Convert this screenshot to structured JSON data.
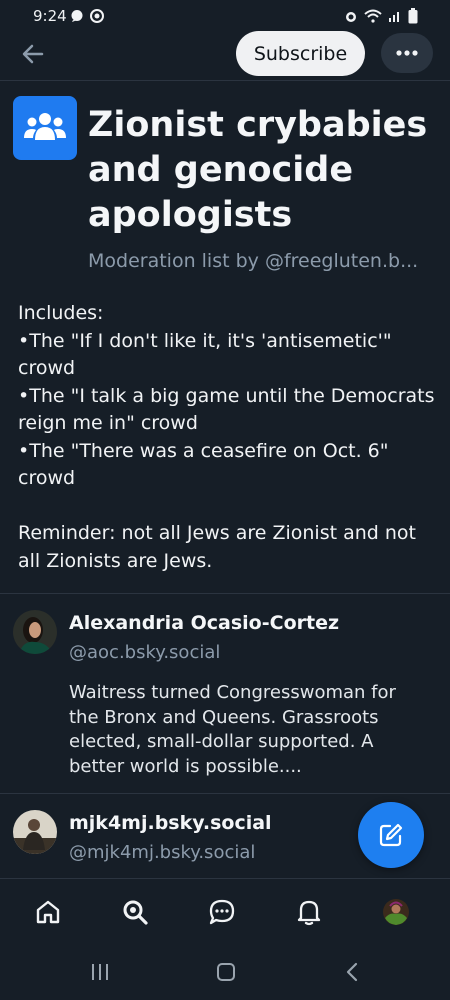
{
  "status_bar": {
    "time": "9:24"
  },
  "header": {
    "subscribe_label": "Subscribe",
    "more_label": "•••"
  },
  "list": {
    "title": "Zionist crybabies and genocide apologists",
    "byline": "Moderation list by @freegluten.b...",
    "description_lines": [
      "Includes:",
      "•The \"If I don't like it, it's 'antisemetic'\" crowd",
      "•The \"I talk a big game until the Democrats reign me in\" crowd",
      "•The \"There was a ceasefire on Oct. 6\" crowd",
      "",
      "Reminder: not all Jews are Zionist and not all Zionists are Jews."
    ]
  },
  "members": [
    {
      "name": "Alexandria Ocasio-Cortez",
      "handle": "@aoc.bsky.social",
      "bio": "Waitress turned Congresswoman for the Bronx and Queens. Grassroots elected, small-dollar supported. A better world is possible...."
    },
    {
      "name": "mjk4mj.bsky.social",
      "handle": "@mjk4mj.bsky.social",
      "bio": ""
    }
  ],
  "icons": {
    "back": "arrow-left-icon",
    "more": "ellipsis-icon",
    "list_avatar": "users-group-icon",
    "compose": "compose-icon",
    "nav": [
      "home-icon",
      "search-icon",
      "chat-icon",
      "bell-icon",
      "profile-avatar"
    ]
  },
  "colors": {
    "background": "#161e27",
    "accent": "#1e7ff0",
    "muted_text": "#8c9bab"
  }
}
